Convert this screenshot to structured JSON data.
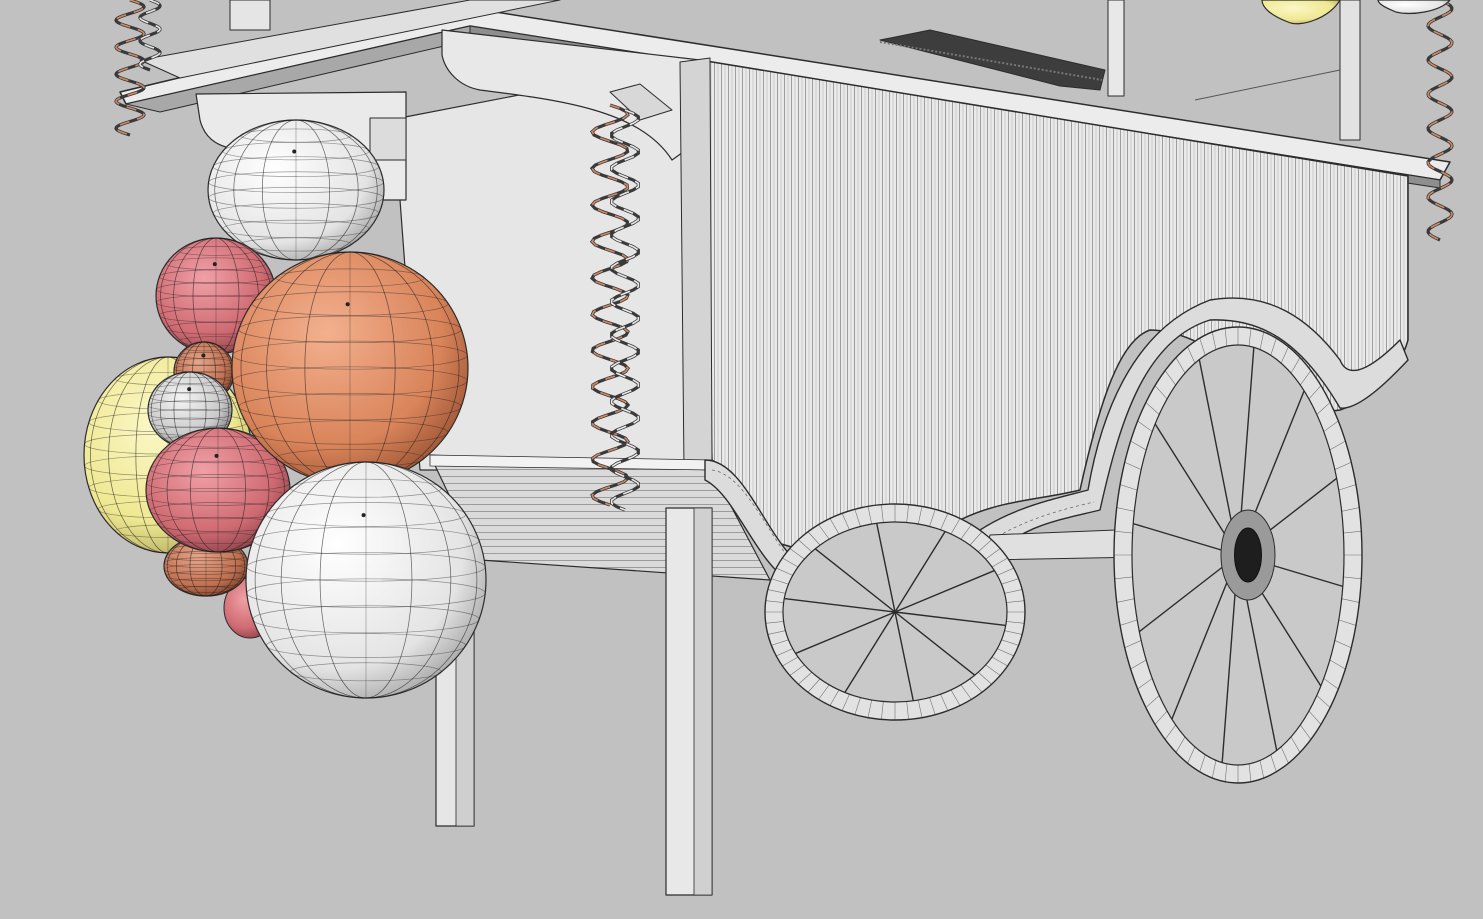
{
  "scene": {
    "subject": "",
    "colors": {
      "background": "#c1c1c1",
      "surface_light": "#ededed",
      "surface_mid": "#d6d6d6",
      "surface_shadow": "#a9a9a9",
      "surface_dark": "#7a7a7a",
      "edge": "#2c2c2c",
      "balloon_orange": "#d9845a",
      "balloon_red": "#cf6a72",
      "balloon_yellow": "#efe892",
      "balloon_white": "#efefef",
      "ribbon_copper": "#cf8a64",
      "ribbon_dark": "#3a3a3a"
    },
    "balloons": [
      {
        "name": "balloon-white-top",
        "color": "balloon_white"
      },
      {
        "name": "balloon-red-upper",
        "color": "balloon_red"
      },
      {
        "name": "balloon-orange-large",
        "color": "balloon_orange"
      },
      {
        "name": "balloon-yellow",
        "color": "balloon_yellow"
      },
      {
        "name": "balloon-small-brown",
        "color": "balloon_orange"
      },
      {
        "name": "balloon-small-grey",
        "color": "balloon_white"
      },
      {
        "name": "balloon-red-lower",
        "color": "balloon_red"
      },
      {
        "name": "balloon-orange-small",
        "color": "balloon_orange"
      },
      {
        "name": "balloon-white-large",
        "color": "balloon_white"
      }
    ],
    "wheels": [
      {
        "name": "rear-wheel",
        "spokes": 10
      },
      {
        "name": "front-wheel",
        "spokes": 12
      }
    ]
  }
}
